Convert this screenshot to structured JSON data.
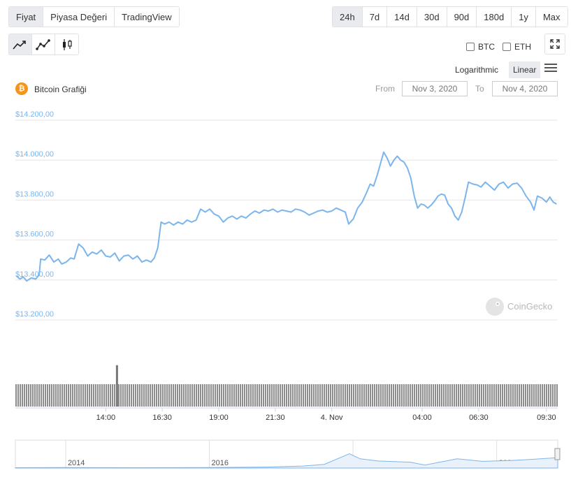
{
  "tabs": [
    {
      "label": "Fiyat",
      "active": true
    },
    {
      "label": "Piyasa Değeri",
      "active": false
    },
    {
      "label": "TradingView",
      "active": false
    }
  ],
  "ranges": [
    {
      "label": "24h",
      "active": true
    },
    {
      "label": "7d",
      "active": false
    },
    {
      "label": "14d",
      "active": false
    },
    {
      "label": "30d",
      "active": false
    },
    {
      "label": "90d",
      "active": false
    },
    {
      "label": "180d",
      "active": false
    },
    {
      "label": "1y",
      "active": false
    },
    {
      "label": "Max",
      "active": false
    }
  ],
  "chart_types": [
    "line-chart-icon",
    "point-line-chart-icon",
    "candlestick-icon"
  ],
  "compare": {
    "btc": "BTC",
    "eth": "ETH"
  },
  "scale": {
    "log": "Logarithmic",
    "linear": "Linear",
    "selected": "linear"
  },
  "coin": {
    "symbol": "₿",
    "title": "Bitcoin Grafiği"
  },
  "date_range": {
    "from_label": "From",
    "from_value": "Nov 3, 2020",
    "to_label": "To",
    "to_value": "Nov 4, 2020"
  },
  "watermark": "CoinGecko",
  "colors": {
    "line": "#7cb5ec",
    "volume": "#8c8c8c",
    "bitcoin": "#f7931a",
    "active_button": "#e9ebee"
  },
  "chart_data": {
    "type": "line",
    "title": "Bitcoin Grafiği",
    "yticks": [
      "$13.200,00",
      "$13.400,00",
      "$13.600,00",
      "$13.800,00",
      "$14.000,00",
      "$14.200,00"
    ],
    "yvalues": [
      13200,
      13400,
      13600,
      13800,
      14000,
      14200
    ],
    "ylim": [
      13200,
      14200
    ],
    "xticks": [
      "14:00",
      "16:30",
      "19:00",
      "21:30",
      "4. Nov",
      "04:00",
      "06:30",
      "09:30"
    ],
    "xtick_hours": [
      14,
      16.5,
      19,
      21.5,
      24,
      28,
      30.5,
      33.5
    ],
    "xlim_hours": [
      10,
      34
    ],
    "grid": true,
    "series": [
      {
        "price": [
          [
            10.05,
            13420
          ],
          [
            10.2,
            13405
          ],
          [
            10.35,
            13415
          ],
          [
            10.5,
            13395
          ],
          [
            10.7,
            13410
          ],
          [
            10.9,
            13405
          ],
          [
            11.05,
            13425
          ],
          [
            11.12,
            13505
          ],
          [
            11.3,
            13500
          ],
          [
            11.5,
            13525
          ],
          [
            11.7,
            13490
          ],
          [
            11.9,
            13505
          ],
          [
            12.05,
            13480
          ],
          [
            12.25,
            13490
          ],
          [
            12.45,
            13510
          ],
          [
            12.6,
            13505
          ],
          [
            12.8,
            13580
          ],
          [
            13.0,
            13560
          ],
          [
            13.2,
            13520
          ],
          [
            13.4,
            13540
          ],
          [
            13.6,
            13530
          ],
          [
            13.8,
            13550
          ],
          [
            14.0,
            13520
          ],
          [
            14.2,
            13515
          ],
          [
            14.4,
            13535
          ],
          [
            14.6,
            13495
          ],
          [
            14.8,
            13520
          ],
          [
            15.0,
            13525
          ],
          [
            15.2,
            13505
          ],
          [
            15.4,
            13520
          ],
          [
            15.6,
            13490
          ],
          [
            15.8,
            13500
          ],
          [
            16.0,
            13490
          ],
          [
            16.15,
            13510
          ],
          [
            16.3,
            13560
          ],
          [
            16.45,
            13690
          ],
          [
            16.6,
            13680
          ],
          [
            16.8,
            13690
          ],
          [
            17.0,
            13675
          ],
          [
            17.2,
            13690
          ],
          [
            17.4,
            13680
          ],
          [
            17.6,
            13700
          ],
          [
            17.8,
            13690
          ],
          [
            18.0,
            13700
          ],
          [
            18.2,
            13755
          ],
          [
            18.4,
            13740
          ],
          [
            18.6,
            13755
          ],
          [
            18.8,
            13730
          ],
          [
            19.0,
            13720
          ],
          [
            19.2,
            13690
          ],
          [
            19.4,
            13710
          ],
          [
            19.6,
            13720
          ],
          [
            19.8,
            13705
          ],
          [
            20.0,
            13720
          ],
          [
            20.2,
            13710
          ],
          [
            20.4,
            13730
          ],
          [
            20.6,
            13745
          ],
          [
            20.8,
            13735
          ],
          [
            21.0,
            13750
          ],
          [
            21.2,
            13745
          ],
          [
            21.4,
            13755
          ],
          [
            21.6,
            13740
          ],
          [
            21.8,
            13750
          ],
          [
            22.0,
            13745
          ],
          [
            22.2,
            13740
          ],
          [
            22.4,
            13755
          ],
          [
            22.6,
            13750
          ],
          [
            22.8,
            13740
          ],
          [
            23.0,
            13725
          ],
          [
            23.2,
            13735
          ],
          [
            23.4,
            13745
          ],
          [
            23.6,
            13750
          ],
          [
            23.8,
            13740
          ],
          [
            24.0,
            13745
          ],
          [
            24.2,
            13760
          ],
          [
            24.4,
            13750
          ],
          [
            24.6,
            13740
          ],
          [
            24.75,
            13680
          ],
          [
            24.95,
            13705
          ],
          [
            25.15,
            13760
          ],
          [
            25.35,
            13790
          ],
          [
            25.55,
            13840
          ],
          [
            25.7,
            13880
          ],
          [
            25.85,
            13870
          ],
          [
            26.0,
            13920
          ],
          [
            26.15,
            13980
          ],
          [
            26.3,
            14040
          ],
          [
            26.45,
            14010
          ],
          [
            26.6,
            13970
          ],
          [
            26.75,
            14000
          ],
          [
            26.9,
            14020
          ],
          [
            27.05,
            14000
          ],
          [
            27.2,
            13990
          ],
          [
            27.35,
            13960
          ],
          [
            27.5,
            13910
          ],
          [
            27.65,
            13820
          ],
          [
            27.8,
            13760
          ],
          [
            27.95,
            13780
          ],
          [
            28.1,
            13775
          ],
          [
            28.25,
            13760
          ],
          [
            28.4,
            13775
          ],
          [
            28.55,
            13795
          ],
          [
            28.7,
            13820
          ],
          [
            28.85,
            13830
          ],
          [
            29.0,
            13825
          ],
          [
            29.15,
            13780
          ],
          [
            29.3,
            13760
          ],
          [
            29.45,
            13720
          ],
          [
            29.6,
            13700
          ],
          [
            29.75,
            13740
          ],
          [
            29.9,
            13810
          ],
          [
            30.05,
            13890
          ],
          [
            30.25,
            13880
          ],
          [
            30.45,
            13875
          ],
          [
            30.6,
            13865
          ],
          [
            30.8,
            13890
          ],
          [
            31.0,
            13870
          ],
          [
            31.2,
            13850
          ],
          [
            31.4,
            13880
          ],
          [
            31.6,
            13890
          ],
          [
            31.8,
            13860
          ],
          [
            32.0,
            13880
          ],
          [
            32.2,
            13885
          ],
          [
            32.4,
            13860
          ],
          [
            32.6,
            13820
          ],
          [
            32.8,
            13790
          ],
          [
            32.95,
            13750
          ],
          [
            33.1,
            13820
          ],
          [
            33.3,
            13810
          ],
          [
            33.5,
            13790
          ],
          [
            33.65,
            13815
          ],
          [
            33.8,
            13790
          ],
          [
            33.95,
            13780
          ]
        ]
      }
    ],
    "volume": {
      "spike_hour": 14.45,
      "spike_relative": 1.85,
      "base_relative": 1.0
    },
    "navigator": {
      "labels": [
        "2014",
        "2016",
        "2018",
        "2020"
      ],
      "label_years": [
        2014,
        2016,
        2018,
        2020
      ],
      "xlim_years": [
        2013.3,
        2020.85
      ]
    }
  }
}
